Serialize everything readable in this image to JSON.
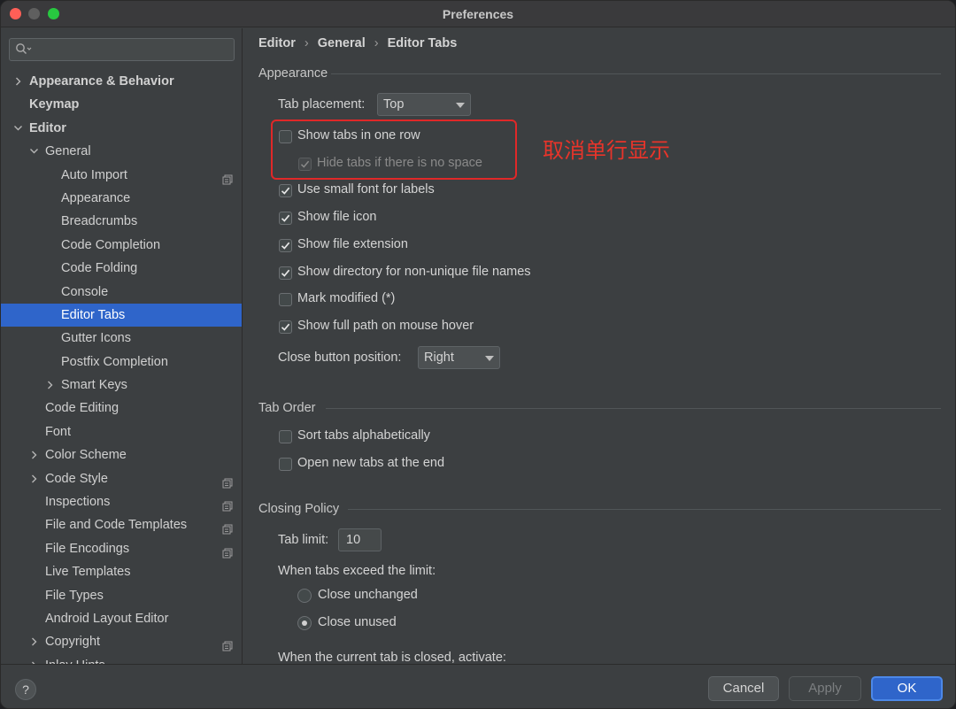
{
  "window": {
    "title": "Preferences"
  },
  "sidebar": {
    "search": {
      "placeholder": "",
      "icon": "search-icon"
    },
    "items": [
      {
        "label": "Appearance & Behavior",
        "level": 0,
        "bold": true,
        "expand": "collapsed",
        "copy": false,
        "selected": false
      },
      {
        "label": "Keymap",
        "level": 0,
        "bold": true,
        "expand": "none",
        "copy": false,
        "selected": false
      },
      {
        "label": "Editor",
        "level": 0,
        "bold": true,
        "expand": "expanded",
        "copy": false,
        "selected": false
      },
      {
        "label": "General",
        "level": 1,
        "bold": false,
        "expand": "expanded",
        "copy": false,
        "selected": false
      },
      {
        "label": "Auto Import",
        "level": 2,
        "bold": false,
        "expand": "none",
        "copy": true,
        "selected": false
      },
      {
        "label": "Appearance",
        "level": 2,
        "bold": false,
        "expand": "none",
        "copy": false,
        "selected": false
      },
      {
        "label": "Breadcrumbs",
        "level": 2,
        "bold": false,
        "expand": "none",
        "copy": false,
        "selected": false
      },
      {
        "label": "Code Completion",
        "level": 2,
        "bold": false,
        "expand": "none",
        "copy": false,
        "selected": false
      },
      {
        "label": "Code Folding",
        "level": 2,
        "bold": false,
        "expand": "none",
        "copy": false,
        "selected": false
      },
      {
        "label": "Console",
        "level": 2,
        "bold": false,
        "expand": "none",
        "copy": false,
        "selected": false
      },
      {
        "label": "Editor Tabs",
        "level": 2,
        "bold": false,
        "expand": "none",
        "copy": false,
        "selected": true
      },
      {
        "label": "Gutter Icons",
        "level": 2,
        "bold": false,
        "expand": "none",
        "copy": false,
        "selected": false
      },
      {
        "label": "Postfix Completion",
        "level": 2,
        "bold": false,
        "expand": "none",
        "copy": false,
        "selected": false
      },
      {
        "label": "Smart Keys",
        "level": 2,
        "bold": false,
        "expand": "collapsed",
        "copy": false,
        "selected": false
      },
      {
        "label": "Code Editing",
        "level": 1,
        "bold": false,
        "expand": "none",
        "copy": false,
        "selected": false
      },
      {
        "label": "Font",
        "level": 1,
        "bold": false,
        "expand": "none",
        "copy": false,
        "selected": false
      },
      {
        "label": "Color Scheme",
        "level": 1,
        "bold": false,
        "expand": "collapsed",
        "copy": false,
        "selected": false
      },
      {
        "label": "Code Style",
        "level": 1,
        "bold": false,
        "expand": "collapsed",
        "copy": true,
        "selected": false
      },
      {
        "label": "Inspections",
        "level": 1,
        "bold": false,
        "expand": "none",
        "copy": true,
        "selected": false
      },
      {
        "label": "File and Code Templates",
        "level": 1,
        "bold": false,
        "expand": "none",
        "copy": true,
        "selected": false
      },
      {
        "label": "File Encodings",
        "level": 1,
        "bold": false,
        "expand": "none",
        "copy": true,
        "selected": false
      },
      {
        "label": "Live Templates",
        "level": 1,
        "bold": false,
        "expand": "none",
        "copy": false,
        "selected": false
      },
      {
        "label": "File Types",
        "level": 1,
        "bold": false,
        "expand": "none",
        "copy": false,
        "selected": false
      },
      {
        "label": "Android Layout Editor",
        "level": 1,
        "bold": false,
        "expand": "none",
        "copy": false,
        "selected": false
      },
      {
        "label": "Copyright",
        "level": 1,
        "bold": false,
        "expand": "collapsed",
        "copy": true,
        "selected": false
      },
      {
        "label": "Inlay Hints",
        "level": 1,
        "bold": false,
        "expand": "collapsed",
        "copy": true,
        "selected": false
      }
    ]
  },
  "breadcrumb": [
    "Editor",
    "General",
    "Editor Tabs"
  ],
  "appearance": {
    "title": "Appearance",
    "tab_placement_label": "Tab placement:",
    "tab_placement_value": "Top",
    "checkboxes": [
      {
        "label": "Show tabs in one row",
        "checked": false,
        "disabled": false,
        "indent": 0
      },
      {
        "label": "Hide tabs if there is no space",
        "checked": true,
        "disabled": true,
        "indent": 1
      },
      {
        "label": "Use small font for labels",
        "checked": true,
        "disabled": false,
        "indent": 0
      },
      {
        "label": "Show file icon",
        "checked": true,
        "disabled": false,
        "indent": 0
      },
      {
        "label": "Show file extension",
        "checked": true,
        "disabled": false,
        "indent": 0
      },
      {
        "label": "Show directory for non-unique file names",
        "checked": true,
        "disabled": false,
        "indent": 0
      },
      {
        "label": "Mark modified (*)",
        "checked": false,
        "disabled": false,
        "indent": 0
      },
      {
        "label": "Show full path on mouse hover",
        "checked": true,
        "disabled": false,
        "indent": 0
      }
    ],
    "close_button_label": "Close button position:",
    "close_button_value": "Right"
  },
  "tab_order": {
    "title": "Tab Order",
    "checkboxes": [
      {
        "label": "Sort tabs alphabetically",
        "checked": false
      },
      {
        "label": "Open new tabs at the end",
        "checked": false
      }
    ]
  },
  "closing_policy": {
    "title": "Closing Policy",
    "tab_limit_label": "Tab limit:",
    "tab_limit_value": "10",
    "exceed_label": "When tabs exceed the limit:",
    "radios": [
      {
        "label": "Close unchanged",
        "checked": false
      },
      {
        "label": "Close unused",
        "checked": true
      }
    ],
    "current_closed_label": "When the current tab is closed, activate:"
  },
  "annotation": {
    "text": "取消单行显示",
    "color": "#e02828"
  },
  "buttons": {
    "help": "?",
    "cancel": "Cancel",
    "apply": "Apply",
    "ok": "OK"
  },
  "colors": {
    "accent": "#2f65ca",
    "background": "#3c3f41"
  }
}
